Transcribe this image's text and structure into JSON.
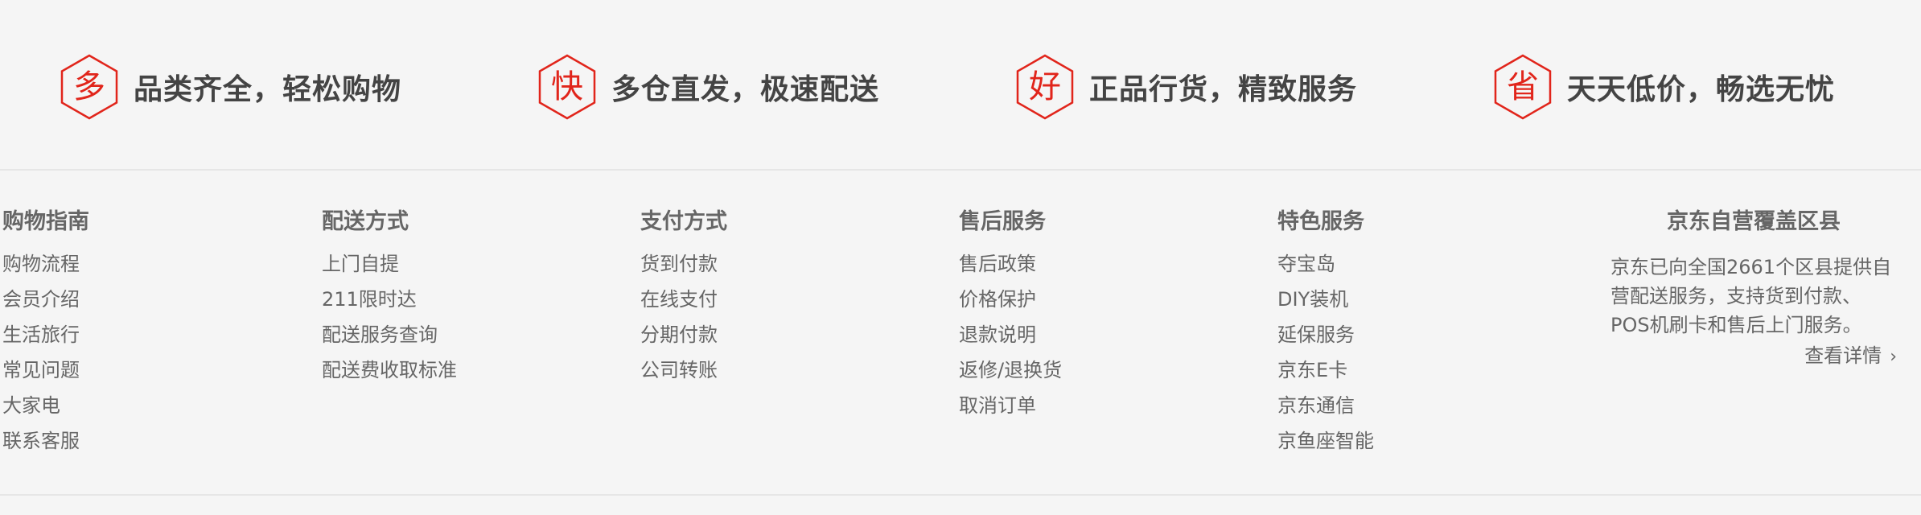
{
  "slogans": [
    {
      "icon_char": "多",
      "icon": "hexagon-duo-icon",
      "text": "品类齐全，轻松购物"
    },
    {
      "icon_char": "快",
      "icon": "hexagon-kuai-icon",
      "text": "多仓直发，极速配送"
    },
    {
      "icon_char": "好",
      "icon": "hexagon-hao-icon",
      "text": "正品行货，精致服务"
    },
    {
      "icon_char": "省",
      "icon": "hexagon-sheng-icon",
      "text": "天天低价，畅选无忧"
    }
  ],
  "columns": [
    {
      "title": "购物指南",
      "items": [
        "购物流程",
        "会员介绍",
        "生活旅行",
        "常见问题",
        "大家电",
        "联系客服"
      ]
    },
    {
      "title": "配送方式",
      "items": [
        "上门自提",
        "211限时达",
        "配送服务查询",
        "配送费收取标准"
      ]
    },
    {
      "title": "支付方式",
      "items": [
        "货到付款",
        "在线支付",
        "分期付款",
        "公司转账"
      ]
    },
    {
      "title": "售后服务",
      "items": [
        "售后政策",
        "价格保护",
        "退款说明",
        "返修/退换货",
        "取消订单"
      ]
    },
    {
      "title": "特色服务",
      "items": [
        "夺宝岛",
        "DIY装机",
        "延保服务",
        "京东E卡",
        "京东通信",
        "京鱼座智能"
      ]
    }
  ],
  "coverage": {
    "title": "京东自营覆盖区县",
    "description": "京东已向全国2661个区县提供自营配送服务，支持货到付款、POS机刷卡和售后上门服务。",
    "more_label": "查看详情",
    "more_icon": "chevron-right-icon",
    "more_glyph": "›"
  },
  "colors": {
    "background": "#f5f5f5",
    "accent": "#e1251b",
    "slogan_text": "#444444",
    "link_text": "#666666",
    "divider": "#e6e6e6"
  }
}
